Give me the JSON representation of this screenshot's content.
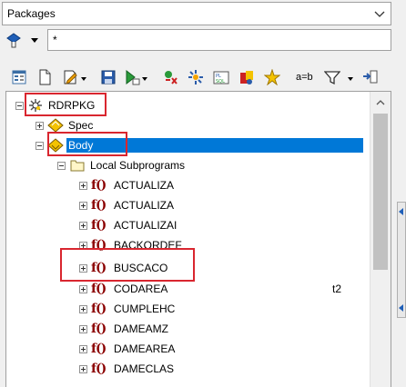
{
  "object_type": {
    "value": "Packages"
  },
  "filter": {
    "value": "*"
  },
  "tree": {
    "root": "RDRPKG",
    "spec": "Spec",
    "body": "Body",
    "local_subprograms": "Local Subprograms",
    "functions": [
      "ACTUALIZA",
      "ACTUALIZA",
      "ACTUALIZAI",
      "BACKORDEF",
      "BUSCACO",
      "CODAREA",
      "CUMPLEHC",
      "DAMEAMZ",
      "DAMEAREA",
      "DAMECLAS"
    ],
    "function_glyph": "f()"
  },
  "toolbar": {
    "compare_label": "a=b"
  },
  "right_panel": {
    "partial_text": "t2"
  },
  "colors": {
    "selection": "#0078d7",
    "annotation": "#d9262f",
    "function_icon": "#8b0000"
  }
}
